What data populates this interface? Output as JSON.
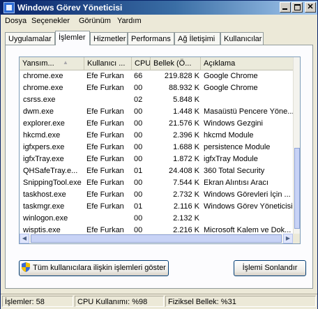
{
  "window": {
    "title": "Windows Görev Yöneticisi"
  },
  "menu": [
    "Dosya",
    "Seçenekler",
    "Görünüm",
    "Yardım"
  ],
  "tabs": [
    "Uygulamalar",
    "İşlemler",
    "Hizmetler",
    "Performans",
    "Ağ İletişimi",
    "Kullanıcılar"
  ],
  "active_tab": "İşlemler",
  "columns": [
    "Yansım...",
    "Kullanıcı ...",
    "CPU",
    "Bellek (Ö...",
    "Açıklama"
  ],
  "processes": [
    {
      "name": "chrome.exe",
      "user": "Efe Furkan",
      "cpu": "66",
      "mem": "219.828 K",
      "desc": "Google Chrome"
    },
    {
      "name": "chrome.exe",
      "user": "Efe Furkan",
      "cpu": "00",
      "mem": "88.932 K",
      "desc": "Google Chrome"
    },
    {
      "name": "csrss.exe",
      "user": "",
      "cpu": "02",
      "mem": "5.848 K",
      "desc": ""
    },
    {
      "name": "dwm.exe",
      "user": "Efe Furkan",
      "cpu": "00",
      "mem": "1.448 K",
      "desc": "Masaüstü Pencere Yöne..."
    },
    {
      "name": "explorer.exe",
      "user": "Efe Furkan",
      "cpu": "00",
      "mem": "21.576 K",
      "desc": "Windows Gezgini"
    },
    {
      "name": "hkcmd.exe",
      "user": "Efe Furkan",
      "cpu": "00",
      "mem": "2.396 K",
      "desc": "hkcmd Module"
    },
    {
      "name": "igfxpers.exe",
      "user": "Efe Furkan",
      "cpu": "00",
      "mem": "1.688 K",
      "desc": "persistence Module"
    },
    {
      "name": "igfxTray.exe",
      "user": "Efe Furkan",
      "cpu": "00",
      "mem": "1.872 K",
      "desc": "igfxTray Module"
    },
    {
      "name": "QHSafeTray.e...",
      "user": "Efe Furkan",
      "cpu": "01",
      "mem": "24.408 K",
      "desc": "360 Total Security"
    },
    {
      "name": "SnippingTool.exe",
      "user": "Efe Furkan",
      "cpu": "00",
      "mem": "7.544 K",
      "desc": "Ekran Alıntısı Aracı"
    },
    {
      "name": "taskhost.exe",
      "user": "Efe Furkan",
      "cpu": "00",
      "mem": "2.732 K",
      "desc": "Windows Görevleri İçin ..."
    },
    {
      "name": "taskmgr.exe",
      "user": "Efe Furkan",
      "cpu": "01",
      "mem": "2.116 K",
      "desc": "Windows Görev Yöneticisi"
    },
    {
      "name": "winlogon.exe",
      "user": "",
      "cpu": "00",
      "mem": "2.132 K",
      "desc": ""
    },
    {
      "name": "wisptis.exe",
      "user": "Efe Furkan",
      "cpu": "00",
      "mem": "2.216 K",
      "desc": "Microsoft Kalem ve Dok..."
    }
  ],
  "buttons": {
    "show_all": "Tüm kullanıcılara ilişkin işlemleri göster",
    "end_process": "İşlemi Sonlandır"
  },
  "status": {
    "processes": "İşlemler: 58",
    "cpu": "CPU Kullanımı: %98",
    "memory": "Fiziksel Bellek: %31"
  },
  "colors": {
    "titlebar": "#0a246a",
    "list_border": "#7f9db9",
    "button_border": "#003c74"
  }
}
